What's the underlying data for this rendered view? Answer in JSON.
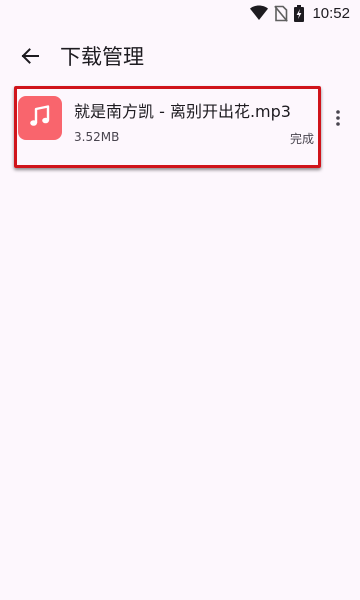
{
  "status_bar": {
    "time": "10:52",
    "icons": [
      "wifi-icon",
      "no-sim-icon",
      "battery-charging-icon"
    ]
  },
  "app_bar": {
    "back_icon": "arrow-back-icon",
    "title": "下载管理"
  },
  "downloads": [
    {
      "icon": "music-note-icon",
      "icon_color": "#f9656d",
      "name": "就是南方凯 - 离别开出花.mp3",
      "size": "3.52MB",
      "status": "完成",
      "more_icon": "more-vert-icon"
    }
  ],
  "colors": {
    "background": "#fdf7fd",
    "highlight": "#d0141b",
    "accent_icon": "#f9656d"
  }
}
